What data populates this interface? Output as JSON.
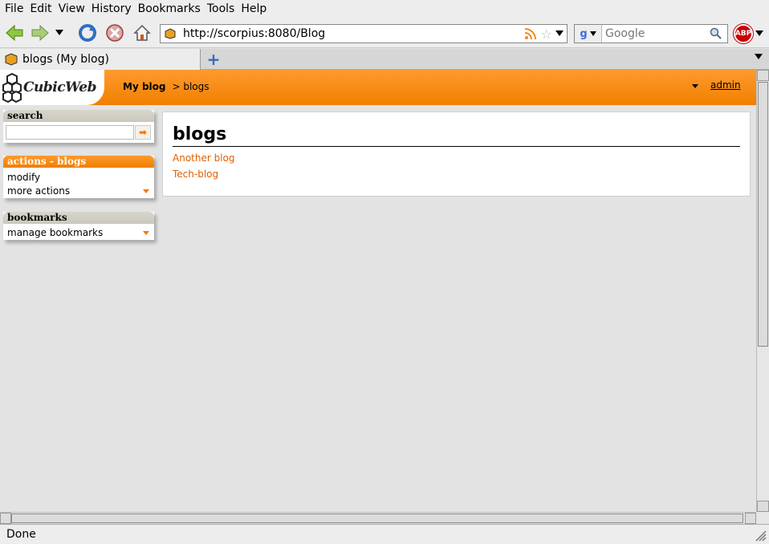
{
  "browser": {
    "menu": [
      "File",
      "Edit",
      "View",
      "History",
      "Bookmarks",
      "Tools",
      "Help"
    ],
    "url": "http://scorpius:8080/Blog",
    "search_placeholder": "Google",
    "abp_label": "ABP",
    "tab_title": "blogs (My blog)",
    "status": "Done"
  },
  "site": {
    "logo_text": "CubicWeb",
    "breadcrumb_root": "My blog",
    "breadcrumb_current": "> blogs",
    "user": "admin"
  },
  "sidebar": {
    "search_title": "search",
    "search_go": "➡",
    "actions_title": "actions - blogs",
    "actions": [
      "modify",
      "more actions"
    ],
    "bookmarks_title": "bookmarks",
    "bookmarks": [
      "manage bookmarks"
    ]
  },
  "main": {
    "heading": "blogs",
    "links": [
      "Another blog",
      "Tech-blog"
    ]
  }
}
